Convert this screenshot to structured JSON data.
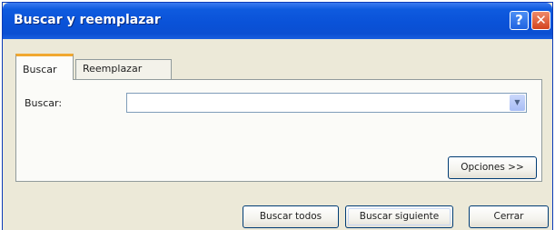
{
  "window": {
    "title": "Buscar y reemplazar"
  },
  "title_buttons": {
    "help": "?",
    "close": "✕"
  },
  "tabs": [
    {
      "label": "Buscar",
      "active": true
    },
    {
      "label": "Reemplazar",
      "active": false
    }
  ],
  "find": {
    "label": "Buscar:",
    "value": ""
  },
  "buttons": {
    "options": "Opciones >>",
    "find_all": "Buscar todos",
    "find_next": "Buscar siguiente",
    "close": "Cerrar"
  },
  "colors": {
    "titlebar": "#0b4fd2",
    "dialog_bg": "#ece9d8",
    "active_tab_accent": "#f1a830"
  }
}
